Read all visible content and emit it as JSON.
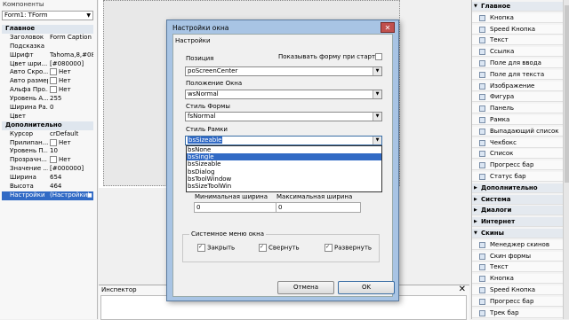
{
  "left_panel": {
    "title": "Компоненты",
    "selector": "Form1: TForm",
    "rows": [
      {
        "type": "section",
        "name": "Главное"
      },
      {
        "name": "Заголовок",
        "value": "Form Caption"
      },
      {
        "name": "Подсказка",
        "value": ""
      },
      {
        "name": "Шрифт",
        "value": "Tahoma,8,#08..."
      },
      {
        "name": "Цвет шри...",
        "value": "[#080000]"
      },
      {
        "name": "Авто Скро...",
        "value": "Нет",
        "check": true
      },
      {
        "name": "Авто размер",
        "value": "Нет",
        "check": true
      },
      {
        "name": "Альфа Про...",
        "value": "Нет",
        "check": true
      },
      {
        "name": "Уровень А...",
        "value": "255"
      },
      {
        "name": "Ширина Ра...",
        "value": "0"
      },
      {
        "name": "Цвет",
        "value": ""
      },
      {
        "type": "section",
        "name": "Дополнительно"
      },
      {
        "name": "Курсор",
        "value": "crDefault"
      },
      {
        "name": "Прилипан...",
        "value": "Нет",
        "check": true
      },
      {
        "name": "Уровень П...",
        "value": "10"
      },
      {
        "name": "Прозрачн...",
        "value": "Нет",
        "check": true
      },
      {
        "name": "Значение ...",
        "value": "[#000000]"
      },
      {
        "name": "Ширина",
        "value": "654"
      },
      {
        "name": "Высота",
        "value": "464"
      },
      {
        "name": "Настройки",
        "value": "(Настройки)",
        "selected": true
      }
    ]
  },
  "inspector": {
    "label": "Инспектор",
    "close": "✕"
  },
  "dialog": {
    "title": "Настройки окна",
    "close": "✕",
    "section": "Настройки",
    "position_label": "Позиция",
    "position_value": "poScreenCenter",
    "show_on_start_label": "Показывать форму при старте",
    "window_state_label": "Положение Окна",
    "window_state_value": "wsNormal",
    "form_style_label": "Стиль Формы",
    "form_style_value": "fsNormal",
    "border_style_label": "Стиль Рамки",
    "border_style_value": "bsSizeable",
    "border_options": [
      "bsNone",
      "bsSingle",
      "bsSizeable",
      "bsDialog",
      "bsToolWindow",
      "bsSizeToolWin"
    ],
    "border_highlight": 1,
    "min_width_label": "Минимальная ширина",
    "min_width_value": "0",
    "max_width_label": "Максимальная ширина",
    "max_width_value": "0",
    "sysmenu_label": "Системное меню окна",
    "close_chk": "Закрыть",
    "minimize_chk": "Свернуть",
    "maximize_chk": "Развернуть",
    "cancel": "Отмена",
    "ok": "OK"
  },
  "palette": [
    {
      "type": "cat",
      "label": "Главное",
      "open": true
    },
    {
      "type": "item",
      "label": "Кнопка"
    },
    {
      "type": "item",
      "label": "Speed Кнопка"
    },
    {
      "type": "item",
      "label": "Текст"
    },
    {
      "type": "item",
      "label": "Ссылка"
    },
    {
      "type": "item",
      "label": "Поле для ввода"
    },
    {
      "type": "item",
      "label": "Поле для текста"
    },
    {
      "type": "item",
      "label": "Изображение"
    },
    {
      "type": "item",
      "label": "Фигура"
    },
    {
      "type": "item",
      "label": "Панель"
    },
    {
      "type": "item",
      "label": "Рамка"
    },
    {
      "type": "item",
      "label": "Выпадающий список"
    },
    {
      "type": "item",
      "label": "Чекбокс"
    },
    {
      "type": "item",
      "label": "Список"
    },
    {
      "type": "item",
      "label": "Прогресс бар"
    },
    {
      "type": "item",
      "label": "Статус бар"
    },
    {
      "type": "cat",
      "label": "Дополнительно",
      "open": false
    },
    {
      "type": "cat",
      "label": "Система",
      "open": false
    },
    {
      "type": "cat",
      "label": "Диалоги",
      "open": false
    },
    {
      "type": "cat",
      "label": "Интернет",
      "open": false
    },
    {
      "type": "cat",
      "label": "Скины",
      "open": true
    },
    {
      "type": "item",
      "label": "Менеджер скинов"
    },
    {
      "type": "item",
      "label": "Скин формы"
    },
    {
      "type": "item",
      "label": "Текст"
    },
    {
      "type": "item",
      "label": "Кнопка"
    },
    {
      "type": "item",
      "label": "Speed Кнопка"
    },
    {
      "type": "item",
      "label": "Прогресс бар"
    },
    {
      "type": "item",
      "label": "Трек бар"
    }
  ],
  "colors": {
    "selection": "#316ac5",
    "dialog_frame": "#a8c4e4",
    "close_button": "#c0504d"
  }
}
